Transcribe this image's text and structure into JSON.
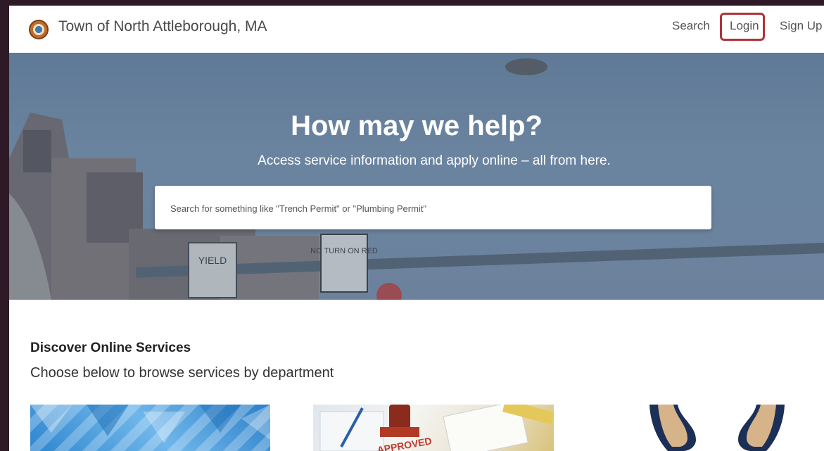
{
  "header": {
    "site_title": "Town of North Attleborough, MA",
    "nav": {
      "search": "Search",
      "login": "Login",
      "signup": "Sign Up"
    },
    "accent_color": "#b03338"
  },
  "hero": {
    "title": "How may we help?",
    "subtitle": "Access service information and apply online – all from here.",
    "search_placeholder": "Search for something like \"Trench Permit\" or \"Plumbing Permit\"",
    "sign_texts": [
      "YIELD",
      "NO TURN ON RED"
    ]
  },
  "discover": {
    "title": "Discover Online Services",
    "subtitle": "Choose below to browse services by department"
  },
  "cards": {
    "approved_stamp": "APPROVED"
  }
}
